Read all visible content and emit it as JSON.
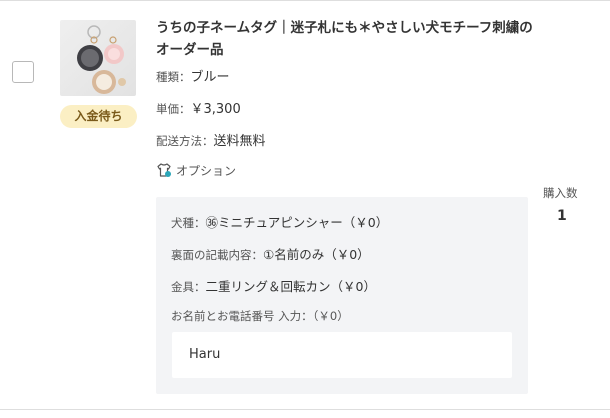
{
  "item": {
    "title": "うちの子ネームタグ｜迷子札にも＊やさしい犬モチーフ刺繍のオーダー品",
    "status_badge": "入金待ち",
    "type_label": "種類：",
    "type_value": "ブルー",
    "price_label": "単価：",
    "price_value": "￥3,300",
    "shipping_label": "配送方法：",
    "shipping_value": "送料無料",
    "option_label": "オプション",
    "option_icon": "shirt-icon",
    "quantity_label": "購入数",
    "quantity_value": "1"
  },
  "options": [
    {
      "label": "犬種：",
      "value": "㊱ミニチュアピンシャー（￥0）"
    },
    {
      "label": "裏面の記載内容：",
      "value": "①名前のみ（￥0）"
    },
    {
      "label": "金具：",
      "value": "二重リング＆回転カン（￥0）"
    }
  ],
  "name_phone": {
    "label": "お名前とお電話番号 入力：（￥0）",
    "value": "Haru"
  },
  "colors": {
    "badge_bg": "#fbefc4",
    "panel_bg": "#f3f4f6",
    "icon_accent": "#2aa6b8"
  }
}
